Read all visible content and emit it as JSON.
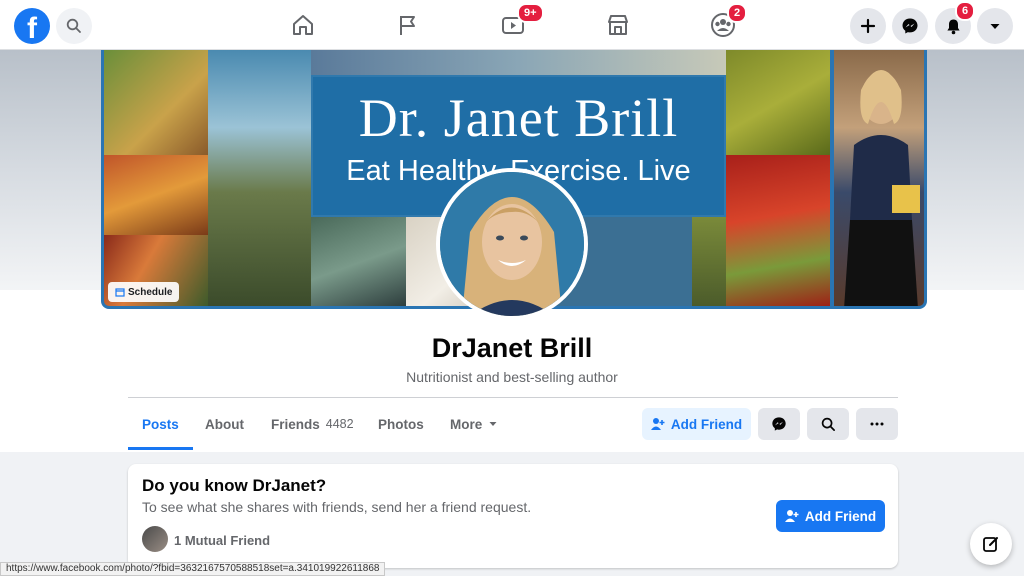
{
  "nav": {
    "logo_letter": "f",
    "watch_badge": "9+",
    "groups_badge": "2",
    "notifications_badge": "6"
  },
  "cover": {
    "banner_title": "Dr. Janet Brill",
    "banner_tagline": "Eat Healthy. Exercise. Live Better.",
    "schedule_label": "Schedule"
  },
  "profile": {
    "name": "DrJanet Brill",
    "bio": "Nutritionist and best-selling author"
  },
  "tabs": [
    {
      "label": "Posts"
    },
    {
      "label": "About"
    },
    {
      "label": "Friends",
      "count": "4482"
    },
    {
      "label": "Photos"
    },
    {
      "label": "More"
    }
  ],
  "actions": {
    "add_friend": "Add Friend"
  },
  "card": {
    "title": "Do you know DrJanet?",
    "subtitle": "To see what she shares with friends, send her a friend request.",
    "add_friend": "Add Friend",
    "mutual": "1 Mutual Friend"
  },
  "status_url": "https://www.facebook.com/photo/?fbid=3632167570588518set=a.341019922611868",
  "colors": {
    "brand": "#1877f2",
    "badge": "#e41e3f",
    "banner": "#1f6ea6"
  }
}
